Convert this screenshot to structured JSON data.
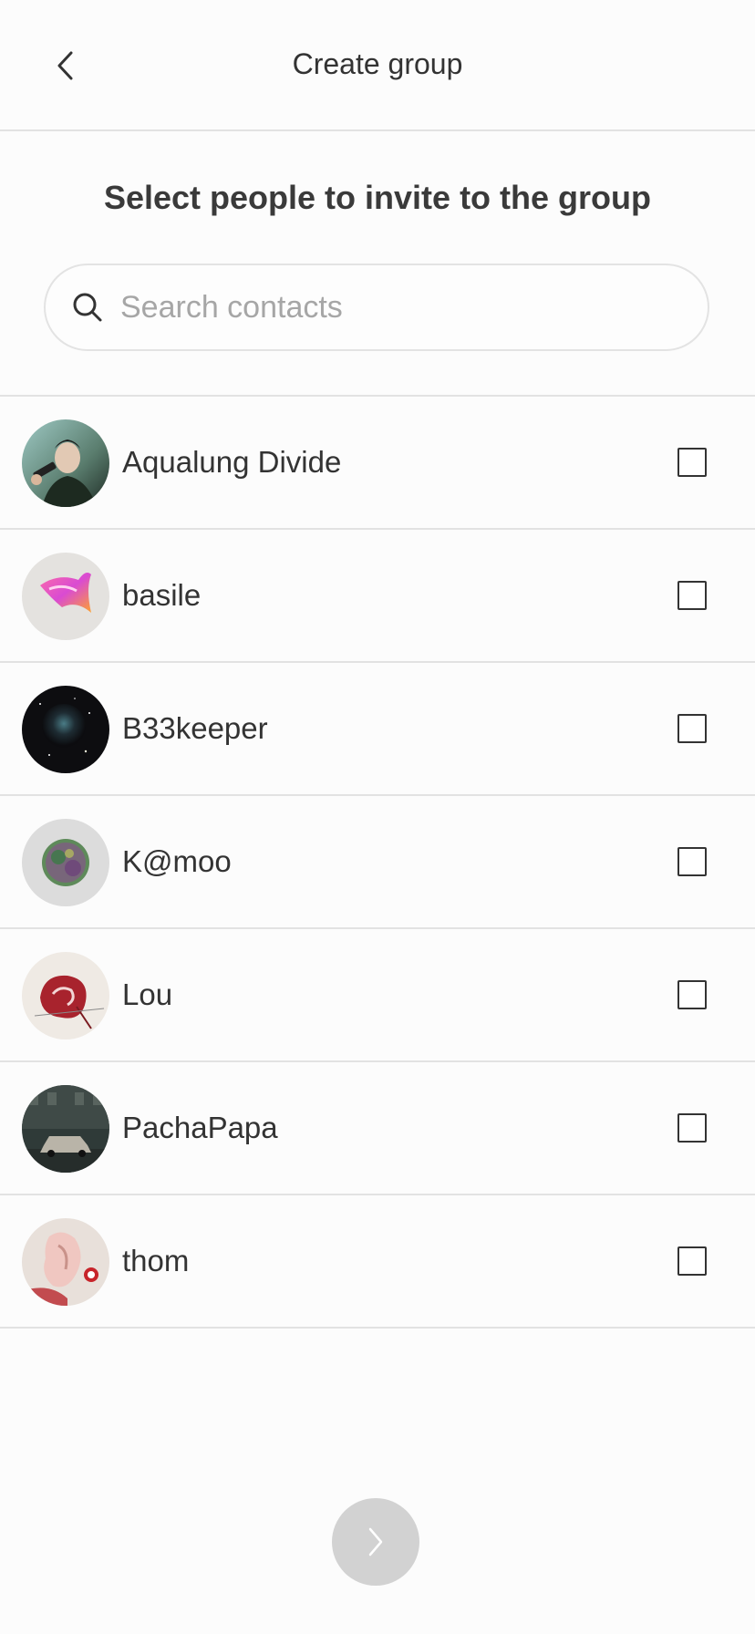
{
  "header": {
    "title": "Create group",
    "back_icon": "chevron-left-icon"
  },
  "subtitle": "Select people to invite to the group",
  "search": {
    "placeholder": "Search contacts",
    "value": "",
    "icon": "search-icon"
  },
  "contacts": [
    {
      "name": "Aqualung Divide",
      "checked": false
    },
    {
      "name": "basile",
      "checked": false
    },
    {
      "name": "B33keeper",
      "checked": false
    },
    {
      "name": "K@moo",
      "checked": false
    },
    {
      "name": "Lou",
      "checked": false
    },
    {
      "name": "PachaPapa",
      "checked": false
    },
    {
      "name": "thom",
      "checked": false
    }
  ],
  "next_button": {
    "icon": "chevron-right-icon",
    "enabled": false
  },
  "colors": {
    "divider": "#e2e2e2",
    "next_button_disabled": "#d2d2d2",
    "placeholder": "#a6a6a6",
    "text": "#333333"
  }
}
